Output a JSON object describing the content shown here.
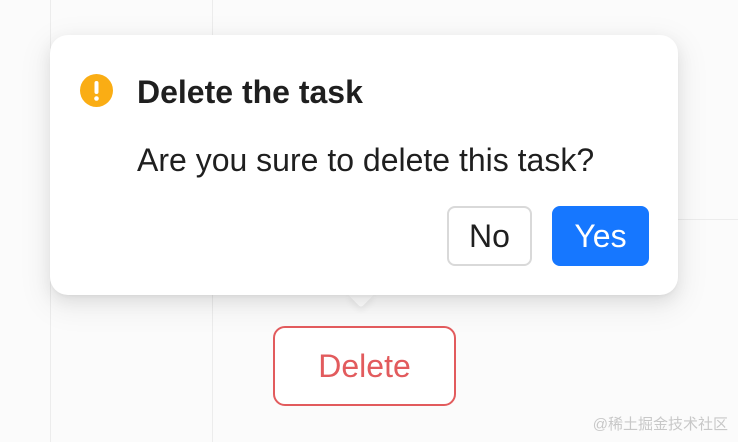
{
  "popconfirm": {
    "icon": "exclamation-circle-icon",
    "icon_color": "#faad14",
    "title": "Delete the task",
    "description": "Are you sure to delete this task?",
    "cancel_label": "No",
    "ok_label": "Yes",
    "ok_color": "#1677ff"
  },
  "trigger": {
    "label": "Delete",
    "color": "#e25b5d"
  },
  "watermark": "@稀土掘金技术社区"
}
